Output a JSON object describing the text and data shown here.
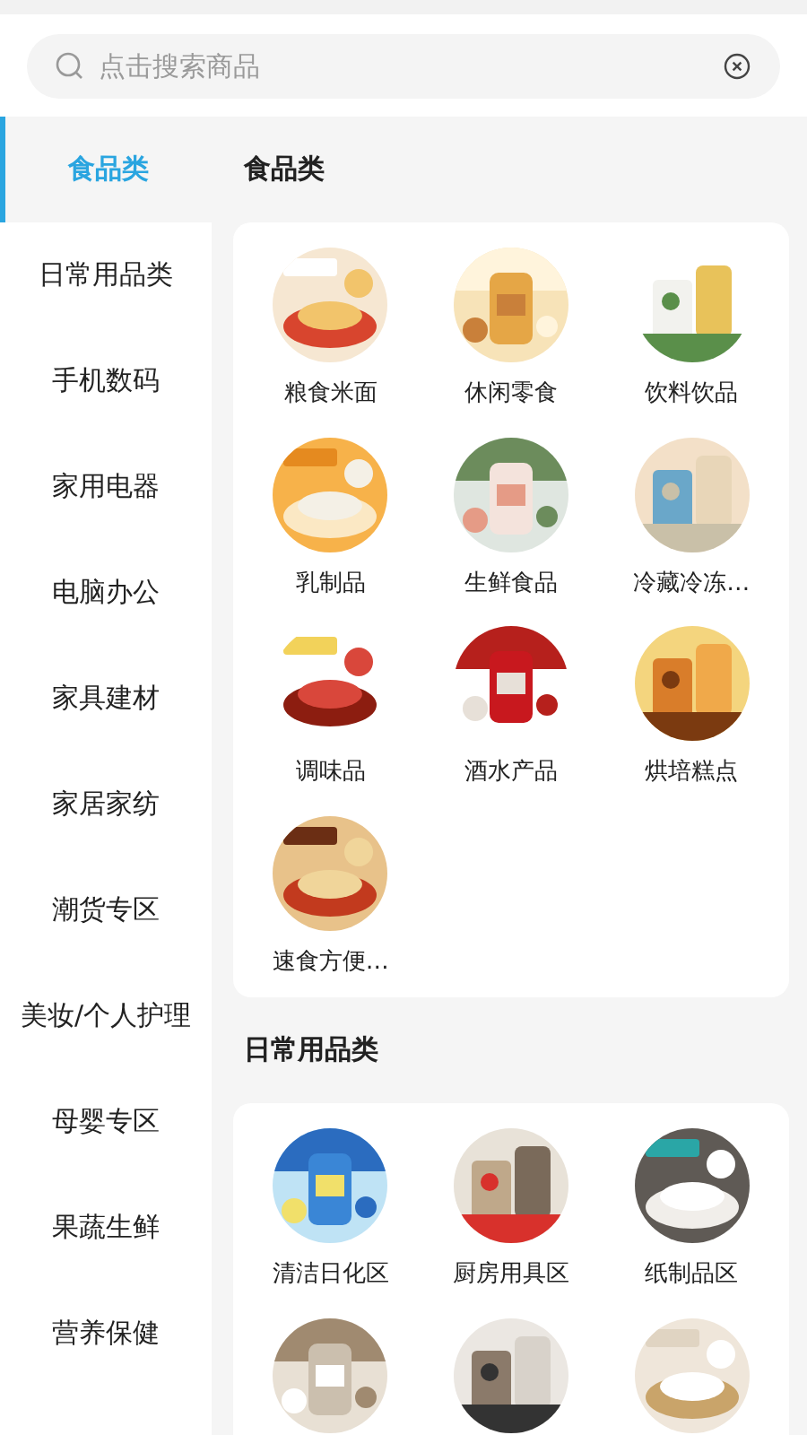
{
  "search": {
    "placeholder": "点击搜索商品"
  },
  "sidebar": {
    "items": [
      {
        "label": "食品类",
        "selected": true
      },
      {
        "label": "日常用品类",
        "selected": false
      },
      {
        "label": "手机数码",
        "selected": false
      },
      {
        "label": "家用电器",
        "selected": false
      },
      {
        "label": "电脑办公",
        "selected": false
      },
      {
        "label": "家具建材",
        "selected": false
      },
      {
        "label": "家居家纺",
        "selected": false
      },
      {
        "label": "潮货专区",
        "selected": false
      },
      {
        "label": "美妆/个人护理",
        "selected": false
      },
      {
        "label": "母婴专区",
        "selected": false
      },
      {
        "label": "果蔬生鲜",
        "selected": false
      },
      {
        "label": "营养保健",
        "selected": false
      }
    ]
  },
  "sections": [
    {
      "title": "食品类",
      "items": [
        {
          "kind": "item",
          "label": "粮食米面"
        },
        {
          "kind": "item",
          "label": "休闲零食"
        },
        {
          "kind": "item",
          "label": "饮料饮品"
        },
        {
          "kind": "item",
          "label": "乳制品"
        },
        {
          "kind": "item",
          "label": "生鲜食品"
        },
        {
          "kind": "item",
          "label": "冷藏冷冻…"
        },
        {
          "kind": "item",
          "label": "调味品"
        },
        {
          "kind": "item",
          "label": "酒水产品"
        },
        {
          "kind": "item",
          "label": "烘培糕点"
        },
        {
          "kind": "item",
          "label": "速食方便…"
        }
      ]
    },
    {
      "title": "日常用品类",
      "items": [
        {
          "kind": "item",
          "label": "清洁日化区"
        },
        {
          "kind": "item",
          "label": "厨房用具区"
        },
        {
          "kind": "item",
          "label": "纸制品区"
        },
        {
          "kind": "picture"
        },
        {
          "kind": "picture"
        },
        {
          "kind": "picture"
        }
      ]
    }
  ]
}
